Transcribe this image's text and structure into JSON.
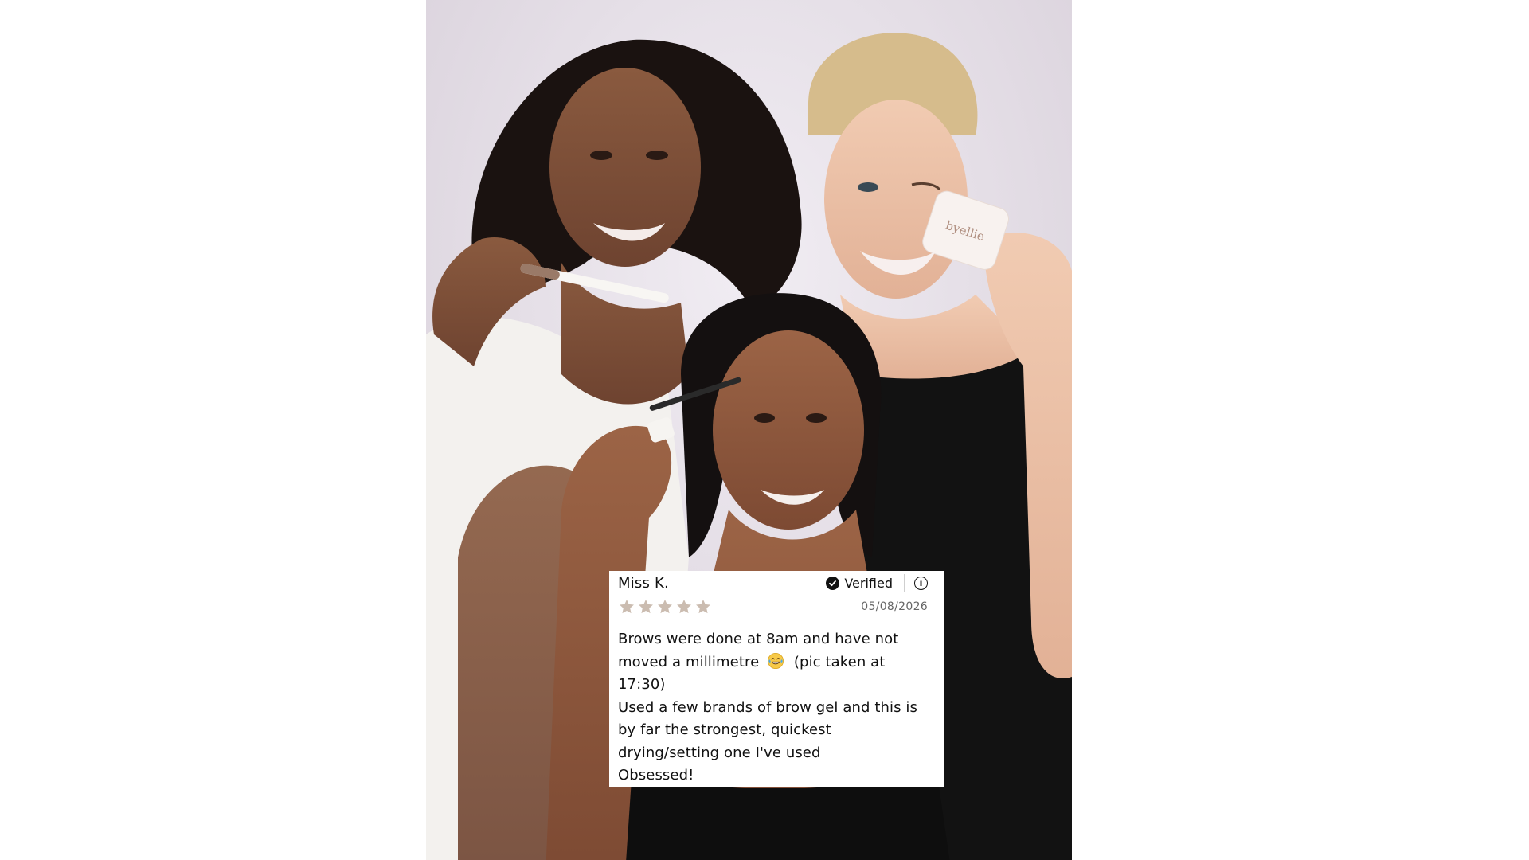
{
  "photo": {
    "product_mark": "byellie"
  },
  "review": {
    "reviewer_name": "Miss K.",
    "verified_label": "Verified",
    "rating": 5,
    "rating_max": 5,
    "date": "05/08/2026",
    "body_lines": [
      {
        "before_emoji": "Brows were done at 8am and have not moved a millimetre",
        "emoji": "tears-of-joy-emoji",
        "after_emoji": "(pic taken at 17:30)"
      },
      {
        "text": "Used a few brands of brow gel and this is by far the strongest, quickest drying/setting one I've used"
      },
      {
        "text": "Obsessed!"
      }
    ],
    "colors": {
      "star": "#cbbcb0",
      "text": "#111111",
      "date": "#666666"
    }
  }
}
